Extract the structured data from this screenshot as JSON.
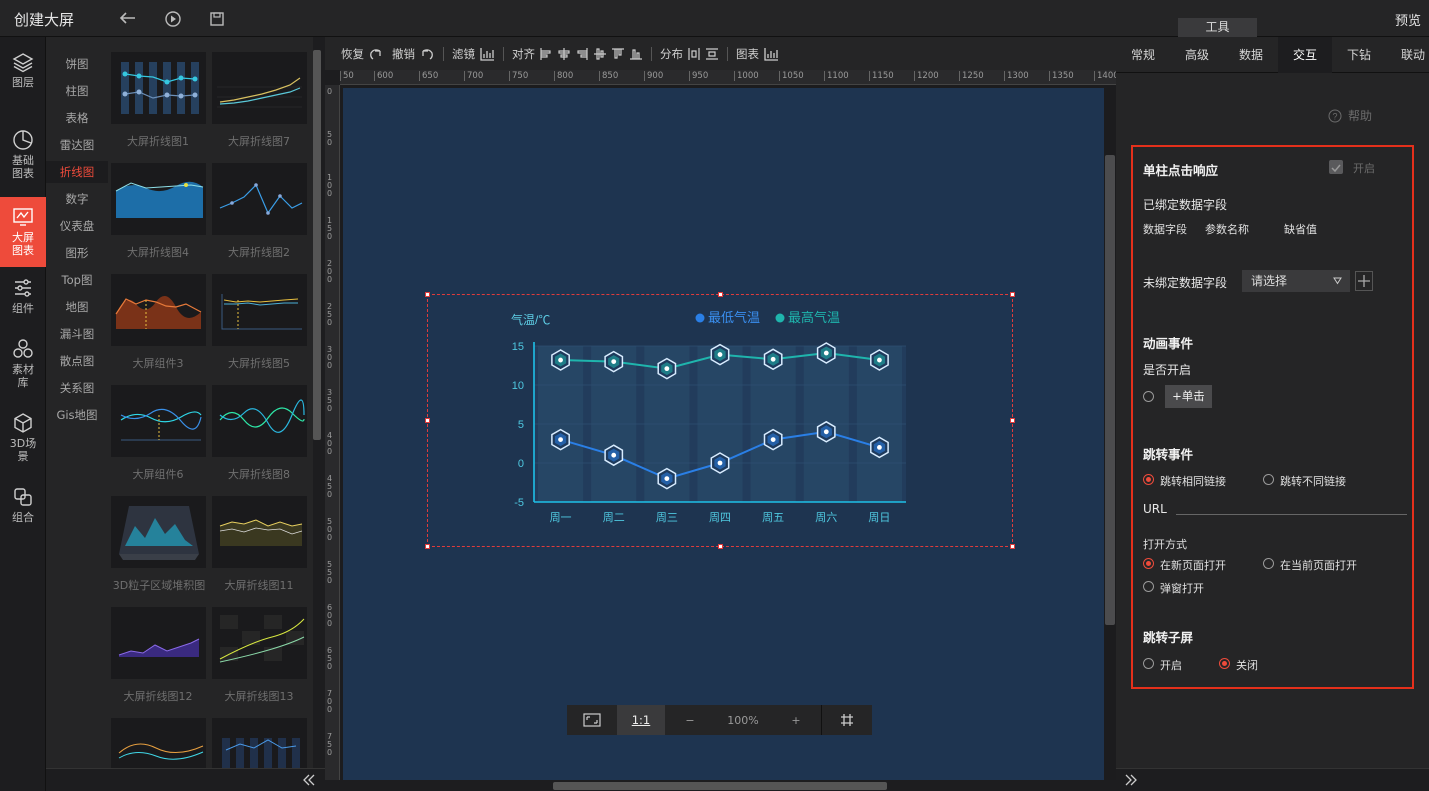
{
  "header": {
    "title": "创建大屏",
    "preview_label": "预览",
    "tool_badge": "工具",
    "icons": [
      "undo-icon",
      "play-icon",
      "save-icon"
    ]
  },
  "leftnav": {
    "items": [
      {
        "label": "图层",
        "icon": "layers-icon"
      },
      {
        "label": "基础图表",
        "icon": "pie-chart-icon"
      },
      {
        "label": "大屏图表",
        "icon": "screen-chart-icon"
      },
      {
        "label": "组件",
        "icon": "sliders-icon"
      },
      {
        "label": "素材库",
        "icon": "material-icon"
      },
      {
        "label": "3D场景",
        "icon": "cube-icon"
      },
      {
        "label": "组合",
        "icon": "combine-icon"
      }
    ]
  },
  "categories": [
    "饼图",
    "柱图",
    "表格",
    "雷达图",
    "折线图",
    "数字",
    "仪表盘",
    "图形",
    "Top图",
    "地图",
    "漏斗图",
    "散点图",
    "关系图",
    "Gis地图"
  ],
  "gallery": [
    "大屏折线图1",
    "大屏折线图7",
    "大屏折线图4",
    "大屏折线图2",
    "大屏组件3",
    "大屏折线图5",
    "大屏组件6",
    "大屏折线图8",
    "3D粒子区域堆积图",
    "大屏折线图11",
    "大屏折线图12",
    "大屏折线图13"
  ],
  "toolbar": {
    "redo": "恢复",
    "undo": "撤销",
    "filter": "滤镜",
    "align": "对齐",
    "distribute": "分布",
    "chart": "图表"
  },
  "ruler": {
    "top": [
      "50",
      "600",
      "650",
      "700",
      "750",
      "800",
      "850",
      "900",
      "950",
      "1000",
      "1050",
      "1100",
      "1150",
      "1200",
      "1250",
      "1300",
      "1350",
      "1400"
    ],
    "left": [
      "0",
      "50",
      "100",
      "150",
      "200",
      "250",
      "300",
      "350",
      "400",
      "450",
      "500",
      "550",
      "600",
      "650",
      "700",
      "750"
    ]
  },
  "zoom": {
    "fit_label": "1:1",
    "minus": "−",
    "value": "100%",
    "plus": "+"
  },
  "chart_data": {
    "type": "line",
    "ylabel": "气温/℃",
    "categories": [
      "周一",
      "周二",
      "周三",
      "周四",
      "周五",
      "周六",
      "周日"
    ],
    "ylim": [
      -5,
      15
    ],
    "yticks": [
      "15",
      "10",
      "5",
      "0",
      "-5"
    ],
    "legend_position": "top-right",
    "series": [
      {
        "name": "最低气温",
        "values": [
          3,
          1,
          -2,
          0,
          3,
          4,
          2
        ],
        "color": "#2a7fe6"
      },
      {
        "name": "最高气温",
        "values": [
          13.2,
          13,
          12.1,
          13.9,
          13.3,
          14.1,
          13.2
        ],
        "color": "#1fb5ad"
      }
    ]
  },
  "rpanel": {
    "tabs": [
      "常规",
      "高级",
      "数据",
      "交互",
      "下钻",
      "联动"
    ],
    "active_tab": "交互",
    "help": "帮助",
    "single_click": "单柱点击响应",
    "enable": "开启",
    "bound_fields": "已绑定数据字段",
    "col_field": "数据字段",
    "col_param": "参数名称",
    "col_default": "缺省值",
    "unbound_fields": "未绑定数据字段",
    "select_placeholder": "请选择",
    "anim_event": "动画事件",
    "is_enabled": "是否开启",
    "click_btn": "+单击",
    "jump_event": "跳转事件",
    "jump_same": "跳转相同链接",
    "jump_diff": "跳转不同链接",
    "url": "URL",
    "open_mode": "打开方式",
    "open_new": "在新页面打开",
    "open_current": "在当前页面打开",
    "open_popup": "弹窗打开",
    "jump_sub": "跳转子屏",
    "sub_on": "开启",
    "sub_off": "关闭"
  }
}
